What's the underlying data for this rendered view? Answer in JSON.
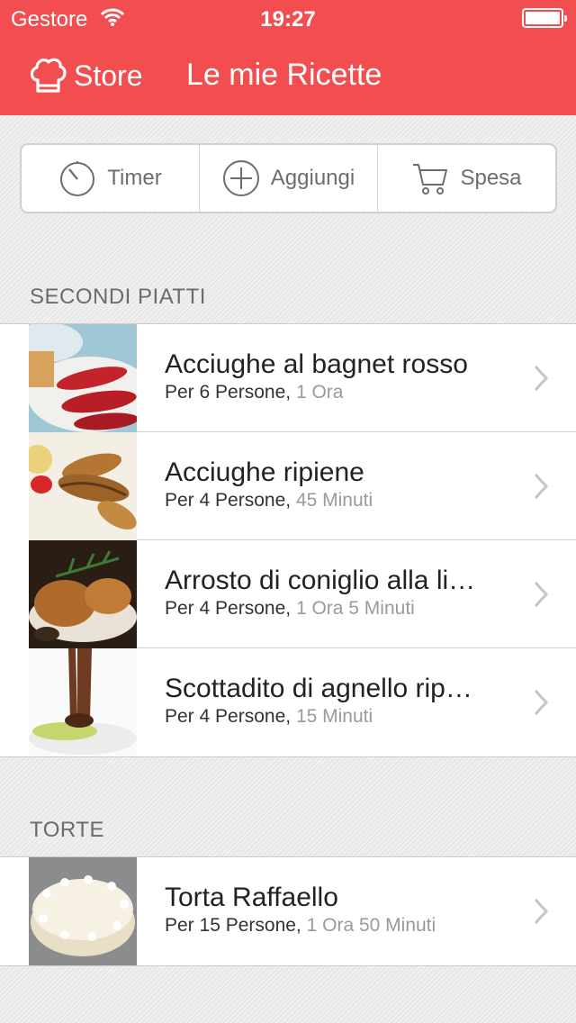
{
  "status_bar": {
    "carrier": "Gestore",
    "time": "19:27",
    "battery_level": 1.0
  },
  "nav": {
    "store_label": "Store",
    "title": "Le mie Ricette"
  },
  "toolbar": {
    "timer_label": "Timer",
    "add_label": "Aggiungi",
    "shopping_label": "Spesa"
  },
  "sections": [
    {
      "title": "SECONDI PIATTI",
      "items": [
        {
          "title": "Acciughe al bagnet rosso",
          "persons": "Per 6 Persone,",
          "duration": "1 Ora"
        },
        {
          "title": "Acciughe ripiene",
          "persons": "Per 4 Persone,",
          "duration": "45 Minuti"
        },
        {
          "title": "Arrosto di coniglio alla li…",
          "persons": "Per 4 Persone,",
          "duration": "1 Ora 5 Minuti"
        },
        {
          "title": "Scottadito di agnello rip…",
          "persons": "Per 4 Persone,",
          "duration": "15 Minuti"
        }
      ]
    },
    {
      "title": "TORTE",
      "items": [
        {
          "title": "Torta Raffaello",
          "persons": "Per 15 Persone,",
          "duration": "1 Ora 50 Minuti"
        }
      ]
    }
  ],
  "icons": {
    "store": "chef-hat-icon",
    "timer": "stopwatch-icon",
    "add": "plus-circle-icon",
    "shopping": "cart-icon",
    "row": "chevron-right-icon"
  },
  "colors": {
    "header": "#f24d4f",
    "background": "#e9e9e9",
    "toolbar_text": "#6d6d6d",
    "duration_text": "#9a9a9a"
  }
}
